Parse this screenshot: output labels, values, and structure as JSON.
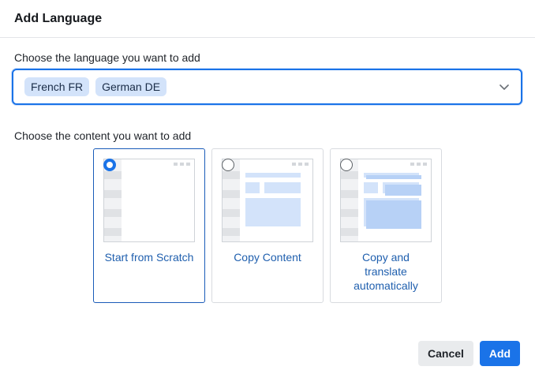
{
  "dialog": {
    "title": "Add Language"
  },
  "language": {
    "label": "Choose the language you want to add",
    "chips": [
      "French FR",
      "German DE"
    ]
  },
  "content": {
    "label": "Choose the content you want to add",
    "options": [
      {
        "label": "Start from Scratch",
        "selected": true
      },
      {
        "label": "Copy Content",
        "selected": false
      },
      {
        "label": "Copy and translate automatically",
        "selected": false
      }
    ]
  },
  "footer": {
    "cancel_label": "Cancel",
    "add_label": "Add"
  },
  "colors": {
    "accent": "#1a73e8",
    "chip_bg": "#d3e3fa",
    "link_text": "#1f5fae"
  }
}
